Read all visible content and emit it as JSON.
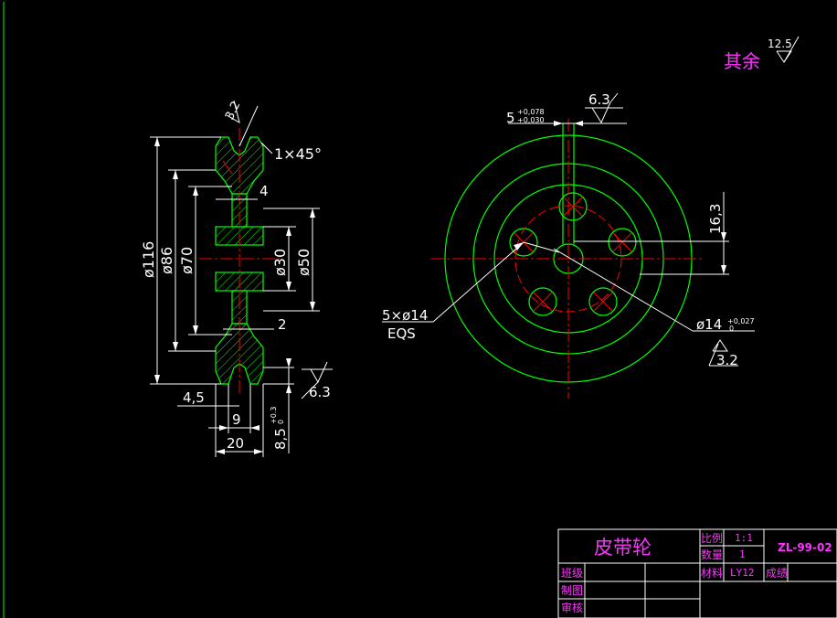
{
  "roughness": {
    "other_label": "其余",
    "other_value": "12.5",
    "groove_value": "3.2",
    "hub_face_value": "6.3",
    "keyway_value": "6.3",
    "bore_value": "3.2"
  },
  "section_view": {
    "chamfer": "1×45°",
    "dim_116": "ø116",
    "dim_86": "ø86",
    "dim_70": "ø70",
    "dim_30": "ø30",
    "dim_50": "ø50",
    "dim_4": "4",
    "dim_2": "2",
    "dim_4_5": "4,5",
    "dim_9": "9",
    "dim_20": "20",
    "dim_8_5_base": "8,5",
    "dim_8_5_tol_upper": "+0.3",
    "dim_8_5_tol_lower": "0"
  },
  "front_view": {
    "keyway_width": "5",
    "keyway_tol_upper": "+0,078",
    "keyway_tol_lower": "+0,030",
    "keyway_depth": "16,3",
    "holes_label": "5×ø14",
    "holes_eqs": "EQS",
    "bore_dim": "ø14",
    "bore_tol_upper": "+0,027",
    "bore_tol_lower": "0"
  },
  "title_block": {
    "part_name": "皮带轮",
    "scale_label": "比例",
    "scale_value": "1:1",
    "drawing_no": "ZL-99-02",
    "qty_label": "数量",
    "qty_value": "1",
    "material_label": "材料",
    "material_value": "LY12",
    "grade_label": "成绩",
    "class_label": "班级",
    "drawn_label": "制图",
    "checked_label": "审核"
  },
  "colors": {
    "background": "#000000",
    "outline": "#00ff00",
    "centerline": "#ff0000",
    "dimension": "#ffffff",
    "text_accent": "#ff33ff"
  }
}
